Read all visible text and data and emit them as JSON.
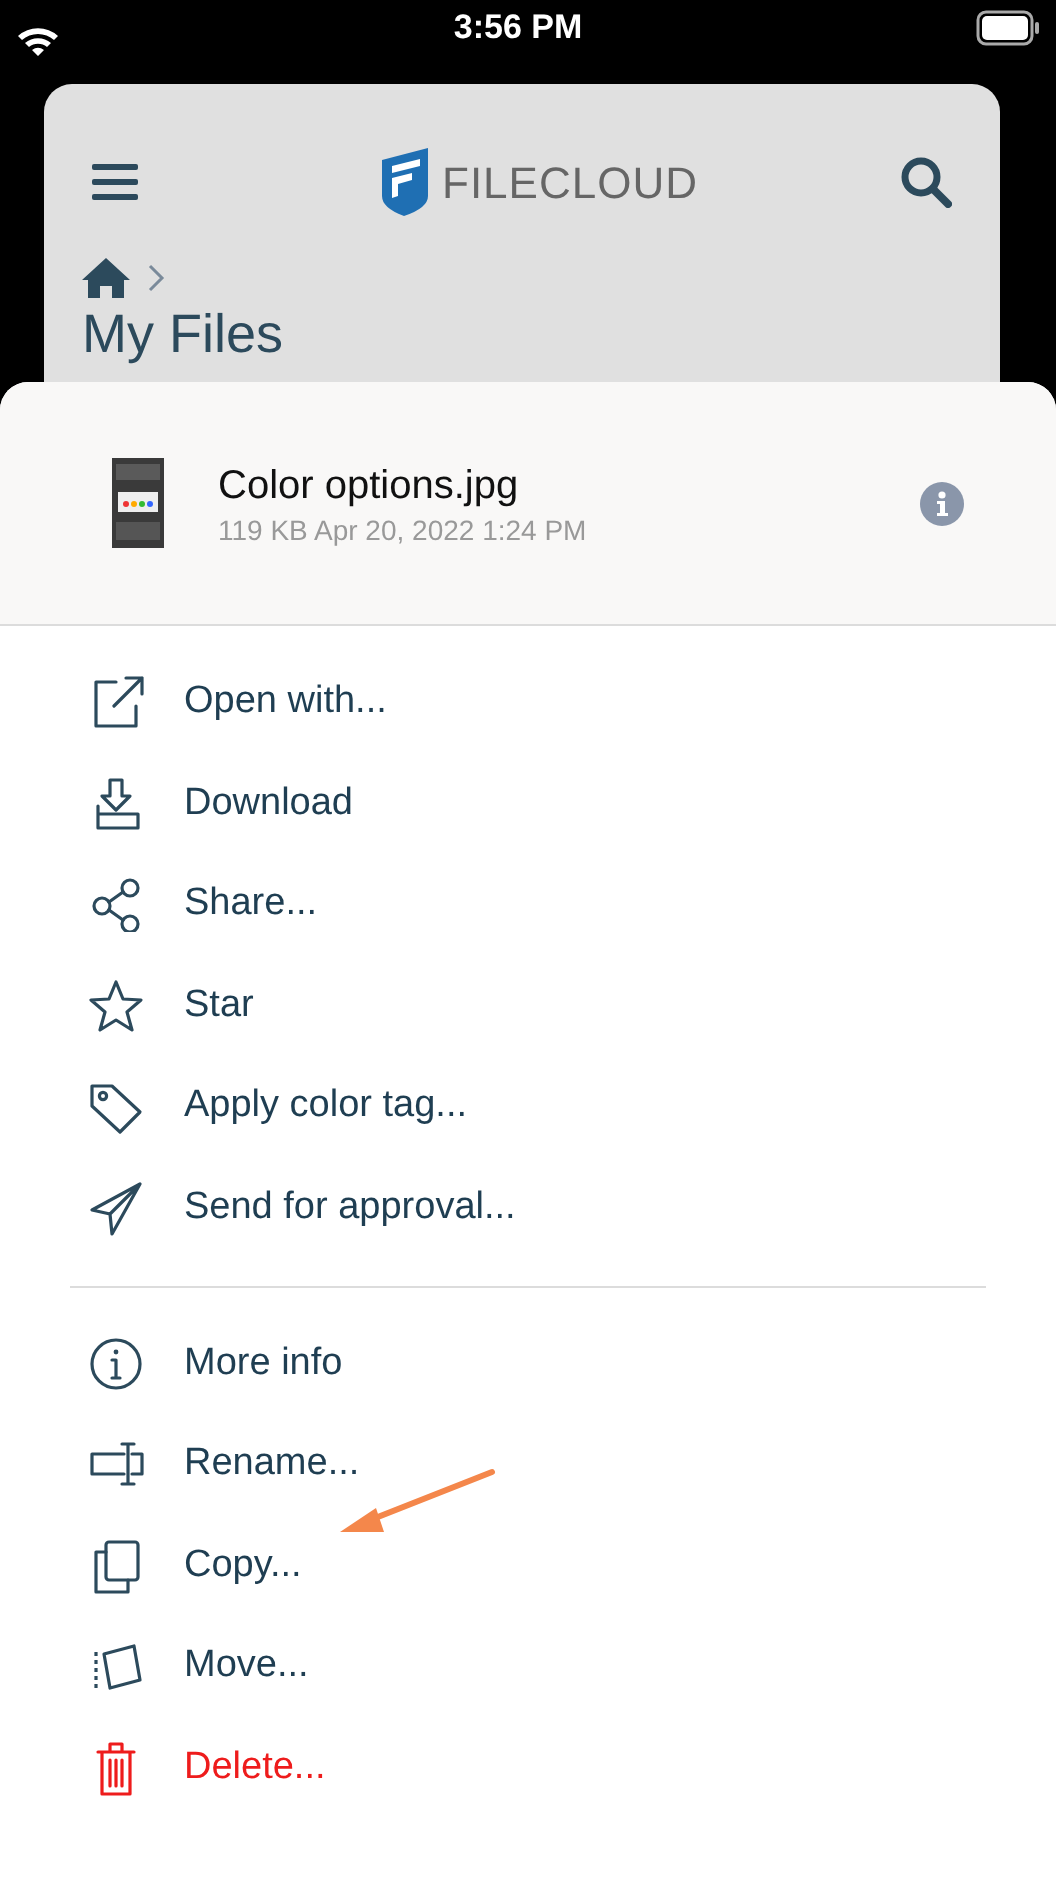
{
  "status_bar": {
    "time": "3:56 PM"
  },
  "header": {
    "logo_text": "FILECLOUD"
  },
  "breadcrumb": {
    "title": "My Files"
  },
  "file": {
    "name": "Color options.jpg",
    "meta": "119 KB Apr 20, 2022 1:24 PM"
  },
  "menu_groups": [
    [
      {
        "kind": "open",
        "label": "Open with...",
        "danger": false
      },
      {
        "kind": "download",
        "label": "Download",
        "danger": false
      },
      {
        "kind": "share",
        "label": "Share...",
        "danger": false
      },
      {
        "kind": "star",
        "label": "Star",
        "danger": false
      },
      {
        "kind": "tag",
        "label": "Apply color tag...",
        "danger": false
      },
      {
        "kind": "send",
        "label": "Send for approval...",
        "danger": false
      }
    ],
    [
      {
        "kind": "info",
        "label": "More info",
        "danger": false
      },
      {
        "kind": "rename",
        "label": "Rename...",
        "danger": false
      },
      {
        "kind": "copy",
        "label": "Copy...",
        "danger": false,
        "pointer": true
      },
      {
        "kind": "move",
        "label": "Move...",
        "danger": false
      },
      {
        "kind": "delete",
        "label": "Delete...",
        "danger": true
      }
    ]
  ]
}
